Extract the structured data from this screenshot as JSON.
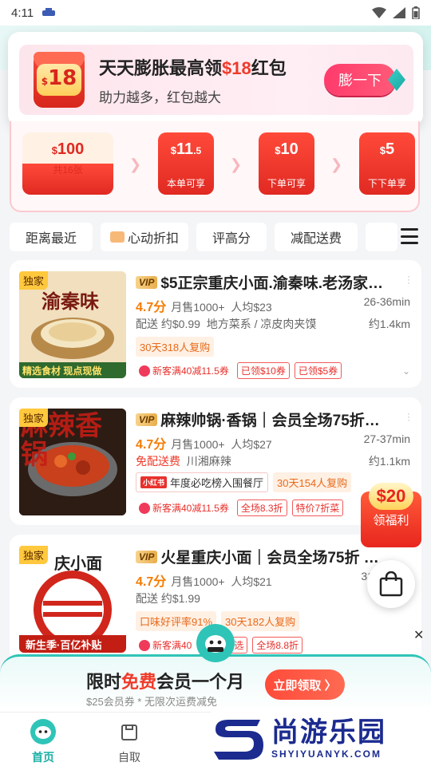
{
  "status_bar": {
    "time": "4:11"
  },
  "popup": {
    "envelope_amount": "18",
    "title_prefix": "天天膨胀最高领",
    "title_amount": "$18",
    "title_suffix": "红包",
    "subtitle": "助力越多，红包越大",
    "button_label": "膨一下"
  },
  "coupons": [
    {
      "currency": "$",
      "amount": "100",
      "decimal": "",
      "label": "共16张"
    },
    {
      "currency": "$",
      "amount": "11",
      "decimal": ".5",
      "label": "本单可享"
    },
    {
      "currency": "$",
      "amount": "10",
      "decimal": "",
      "label": "下单可享"
    },
    {
      "currency": "$",
      "amount": "5",
      "decimal": "",
      "label": "下下单享"
    }
  ],
  "filters": [
    "距离最近",
    "心动折扣",
    "评高分",
    "减配送费"
  ],
  "shops": [
    {
      "exclusive": "独家",
      "vip": "VIP",
      "title": "$5正宗重庆小面.渝秦味.老汤家…",
      "score": "4.7分",
      "monthly_sales": "月售1000+",
      "avg_price": "人均$23",
      "eta": "26-36min",
      "delivery": "配送 约$0.99",
      "category": "地方菜系 / 凉皮肉夹馍",
      "distance": "约1.4km",
      "highlight": "30天318人复购",
      "promo": "新客满40减11.5券",
      "tags": [
        "已领$10券",
        "已领$5券"
      ],
      "thumb_caption": "精选食材 现点现做",
      "thumb_brand": "渝秦味"
    },
    {
      "exclusive": "独家",
      "vip": "VIP",
      "title": "麻辣帅锅·香锅｜会员全场75折…",
      "score": "4.7分",
      "monthly_sales": "月售1000+",
      "avg_price": "人均$27",
      "eta": "27-37min",
      "delivery": "免配送费",
      "category": "川湘麻辣",
      "distance": "约1.1km",
      "rank_badge": "小红书",
      "rank_text": "年度必吃榜入围餐厅",
      "highlight": "30天154人复购",
      "promo": "新客满40减11.5券",
      "tags": [
        "全场8.3折",
        "特价7折菜"
      ],
      "thumb_brand": "麻辣香锅"
    },
    {
      "exclusive": "独家",
      "vip": "VIP",
      "title": "火星重庆小面｜会员全场75折 (…",
      "score": "4.7分",
      "monthly_sales": "月售1000+",
      "avg_price": "人均$21",
      "eta": "31",
      "delivery": "配送 约$1.99",
      "highlight_a": "口味好评率91%",
      "highlight_b": "30天182人复购",
      "promo": "新客满40",
      "tags": [
        "优选",
        "全场8.8折"
      ],
      "thumb_caption": "新生季·百亿补贴",
      "thumb_brand": "庆小面"
    }
  ],
  "welfare": {
    "amount": "$20",
    "label": "领福利"
  },
  "member_banner": {
    "title_prefix": "限时",
    "title_highlight": "免费",
    "title_suffix": "会员一个月",
    "subtitle": "$25会员券 * 无限次运费减免",
    "button_label": "立即领取 〉"
  },
  "tabs": [
    {
      "label": "首页",
      "active": true
    },
    {
      "label": "自取",
      "active": false
    }
  ],
  "watermark": {
    "cn": "尚游乐园",
    "en": "SHYIYUANYK.COM"
  },
  "colors": {
    "accent": "#2fc4b8",
    "red": "#f03a2a",
    "orange": "#f57c00"
  }
}
